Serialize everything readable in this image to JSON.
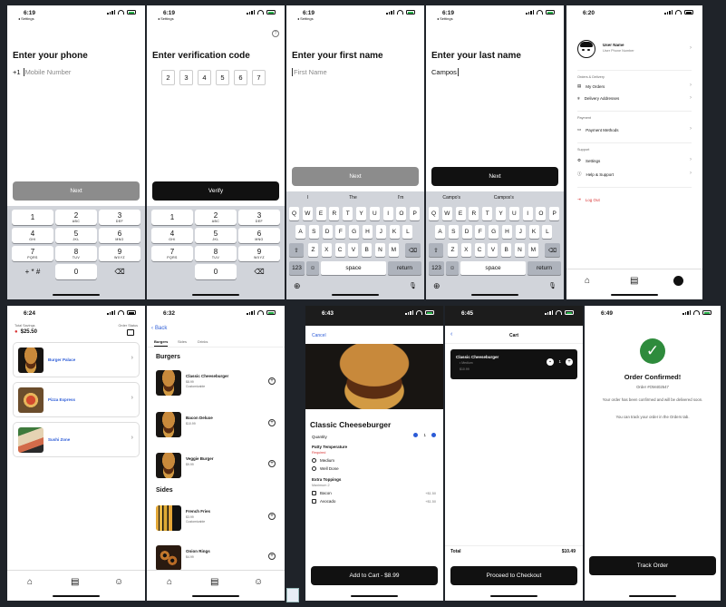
{
  "phone1": {
    "time": "6:19",
    "back": "◂ Settings",
    "title": "Enter your phone",
    "prefix": "+1",
    "placeholder": "Mobile Number",
    "next": "Next",
    "keys": [
      {
        "d": "1",
        "l": ""
      },
      {
        "d": "2",
        "l": "ABC"
      },
      {
        "d": "3",
        "l": "DEF"
      },
      {
        "d": "4",
        "l": "GHI"
      },
      {
        "d": "5",
        "l": "JKL"
      },
      {
        "d": "6",
        "l": "MNO"
      },
      {
        "d": "7",
        "l": "PQRS"
      },
      {
        "d": "8",
        "l": "TUV"
      },
      {
        "d": "9",
        "l": "WXYZ"
      },
      {
        "d": "+ * #",
        "l": ""
      },
      {
        "d": "0",
        "l": ""
      },
      {
        "d": "⌫",
        "l": ""
      }
    ]
  },
  "phone2": {
    "time": "6:19",
    "back": "◂ Settings",
    "title": "Enter verification code",
    "digits": [
      "2",
      "3",
      "4",
      "5",
      "6",
      "7"
    ],
    "verify": "Verify",
    "keys": [
      {
        "d": "1",
        "l": ""
      },
      {
        "d": "2",
        "l": "ABC"
      },
      {
        "d": "3",
        "l": "DEF"
      },
      {
        "d": "4",
        "l": "GHI"
      },
      {
        "d": "5",
        "l": "JKL"
      },
      {
        "d": "6",
        "l": "MNO"
      },
      {
        "d": "7",
        "l": "PQRS"
      },
      {
        "d": "8",
        "l": "TUV"
      },
      {
        "d": "9",
        "l": "WXYZ"
      },
      {
        "d": "",
        "l": ""
      },
      {
        "d": "0",
        "l": ""
      },
      {
        "d": "⌫",
        "l": ""
      }
    ]
  },
  "phone3": {
    "time": "6:19",
    "back": "◂ Settings",
    "title": "Enter your first name",
    "placeholder": "First Name",
    "next": "Next",
    "suggestions": [
      "I",
      "The",
      "I'm"
    ]
  },
  "phone4": {
    "time": "6:19",
    "back": "◂ Settings",
    "title": "Enter your last name",
    "value": "Campos",
    "next": "Next",
    "suggestions": [
      "Campo's",
      "Campos's",
      ""
    ]
  },
  "keyboard": {
    "row1": [
      "Q",
      "W",
      "E",
      "R",
      "T",
      "Y",
      "U",
      "I",
      "O",
      "P"
    ],
    "row2": [
      "A",
      "S",
      "D",
      "F",
      "G",
      "H",
      "J",
      "K",
      "L"
    ],
    "row3": [
      "Z",
      "X",
      "C",
      "V",
      "B",
      "N",
      "M"
    ],
    "num": "123",
    "space": "space",
    "ret": "return"
  },
  "phone5": {
    "time": "6:20",
    "user_name": "User Name",
    "user_phone": "User Phone Number",
    "sections": [
      {
        "title": "Orders & Delivery",
        "items": [
          "My Orders",
          "Delivery Addresses"
        ]
      },
      {
        "title": "Payment",
        "items": [
          "Payment Methods"
        ]
      },
      {
        "title": "Support",
        "items": [
          "Settings",
          "Help & Support"
        ]
      }
    ],
    "logout": "Log Out"
  },
  "phone6": {
    "time": "6:24",
    "savings_label": "Total Savings",
    "savings": "$25.50",
    "status_label": "Order Status",
    "restaurants": [
      "Burger Palace",
      "Pizza Express",
      "Sushi Zone"
    ]
  },
  "phone7": {
    "time": "6:32",
    "back": "Back",
    "tabs": [
      "Burgers",
      "Sides",
      "Drinks"
    ],
    "sections": [
      {
        "title": "Burgers",
        "items": [
          {
            "name": "Classic Cheeseburger",
            "price": "$8.99",
            "custom": "Customizable"
          },
          {
            "name": "Bacon Deluxe",
            "price": "$10.99",
            "custom": ""
          },
          {
            "name": "Veggie Burger",
            "price": "$9.99",
            "custom": ""
          }
        ]
      },
      {
        "title": "Sides",
        "items": [
          {
            "name": "French Fries",
            "price": "$3.99",
            "custom": "Customizable"
          },
          {
            "name": "Onion Rings",
            "price": "$4.99",
            "custom": ""
          }
        ]
      }
    ]
  },
  "phone8": {
    "time": "6:43",
    "cancel": "Cancel",
    "title": "Classic Cheeseburger",
    "quantity_label": "Quantity",
    "quantity": "1",
    "temp_label": "Patty Temperature",
    "required": "Required",
    "temps": [
      "Medium",
      "Well Done"
    ],
    "toppings_label": "Extra Toppings",
    "toppings_max": "Maximum 2",
    "toppings": [
      {
        "name": "Bacon",
        "price": "+$1.50"
      },
      {
        "name": "Avocado",
        "price": "+$1.50"
      }
    ],
    "cta": "Add to Cart - $8.99"
  },
  "phone9": {
    "time": "6:45",
    "title": "Cart",
    "item_name": "Classic Cheeseburger",
    "item_opt": "• Medium",
    "item_price": "$10.99",
    "qty": "1",
    "total_label": "Total",
    "total": "$10.49",
    "cta": "Proceed to Checkout"
  },
  "phone10": {
    "time": "6:49",
    "title": "Order Confirmed!",
    "order_no": "Order #OM402547",
    "msg1": "Your order has been confirmed and will be delivered soon.",
    "msg2": "You can track your order in the Orders tab.",
    "cta": "Track Order"
  },
  "colors": {
    "accent_blue": "#2b5bd7",
    "success": "#2e8b3c",
    "danger": "#d93636",
    "dark": "#111111"
  }
}
